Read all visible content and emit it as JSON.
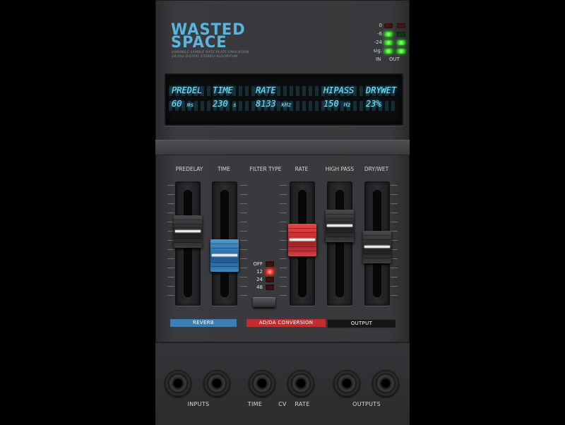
{
  "brand": {
    "line1": "WASTED",
    "line2": "SPACE",
    "sub1": "VARIABLE SAMPLE RATE PLATE EMULATION",
    "sub2": "24 kHz DIGITAL STEREO ALGORITHM"
  },
  "meters": {
    "labels": [
      "0",
      "-6",
      "-24",
      "sig."
    ],
    "in_label": "IN",
    "out_label": "OUT"
  },
  "display": {
    "headers": [
      "PREDEL",
      "TIME",
      "RATE",
      "HIPASS",
      "DRYWET"
    ],
    "values": [
      "60",
      "230",
      "8133",
      "150",
      "23%"
    ],
    "units": [
      "ms",
      "s",
      "kHz",
      "Hz"
    ]
  },
  "faders": {
    "labels": [
      "PREDELAY",
      "TIME",
      "FILTER TYPE",
      "RATE",
      "HIGH PASS",
      "DRY/WET"
    ]
  },
  "filter": {
    "options": [
      "OFF",
      "12",
      "24",
      "48"
    ],
    "selected": "12"
  },
  "sections": {
    "reverb": "REVERB",
    "adda": "AD/DA CONVERSION",
    "output": "OUTPUT"
  },
  "section_colors": {
    "reverb": "#3d7fb5",
    "adda": "#c42d2e",
    "output": "#151617"
  },
  "jacks": {
    "inputs": "INPUTS",
    "time": "TIME",
    "cv": "CV",
    "rate": "RATE",
    "outputs": "OUTPUTS"
  },
  "colors": {
    "accent_blue": "#5ab4dd",
    "display_text": "#7de6ff",
    "led_green": "#3fe42d",
    "led_red": "#ff3a2e"
  }
}
